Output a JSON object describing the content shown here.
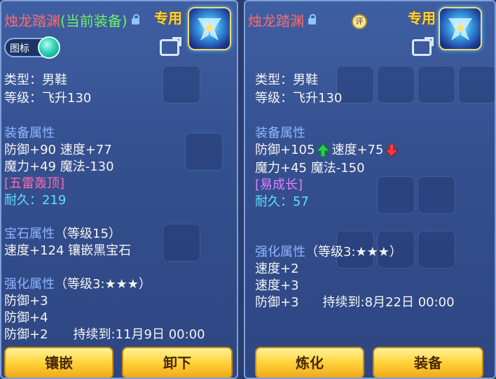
{
  "left": {
    "title": "烛龙踏渊",
    "equipped_tag": "(当前装备)",
    "exclusive": "专用",
    "toggle_label": "图标",
    "type": "类型：男鞋",
    "level": "等级：飞升130",
    "attr_heading": "装备属性",
    "attr1": "防御+90  速度+77",
    "attr2": "魔力+49  魔法-130",
    "special_effect": "[五雷轰顶]",
    "durability": "耐久：219",
    "gem_heading": "宝石属性",
    "gem_level": "（等级15）",
    "gem_line": "速度+124  镶嵌黑宝石",
    "enhance_heading": "强化属性",
    "enhance_level": "（等级3:★★★）",
    "enhance1": "防御+3",
    "enhance2": "防御+4",
    "enhance3": "防御+2",
    "enhance_expire": "持续到:11月9日 00:00",
    "buttons": {
      "inlay": "镶嵌",
      "unequip": "卸下"
    }
  },
  "right": {
    "title": "烛龙踏渊",
    "rate_badge": "评",
    "exclusive": "专用",
    "type": "类型：男鞋",
    "level": "等级：飞升130",
    "attr_heading": "装备属性",
    "def": "防御+105",
    "spd": "速度+75",
    "attr2": "魔力+45  魔法-150",
    "special_effect": "[易成长]",
    "durability": "耐久：57",
    "enhance_heading": "强化属性",
    "enhance_level": "（等级3:★★★）",
    "enhance1": "速度+2",
    "enhance2": "速度+3",
    "enhance3": "防御+3",
    "enhance_expire": "持续到:8月22日 00:00",
    "buttons": {
      "refine": "炼化",
      "equip": "装备"
    }
  },
  "colors": {
    "title": "#ff6a6a",
    "equipped": "#6cf06c",
    "exclusive": "#ffd23a",
    "heading": "#8fb4ff",
    "durability": "#5ee0ff"
  },
  "icons": [
    "lock-icon",
    "share-icon",
    "boots-item-icon",
    "arrow-up-icon",
    "arrow-down-icon",
    "rate-badge-icon"
  ]
}
